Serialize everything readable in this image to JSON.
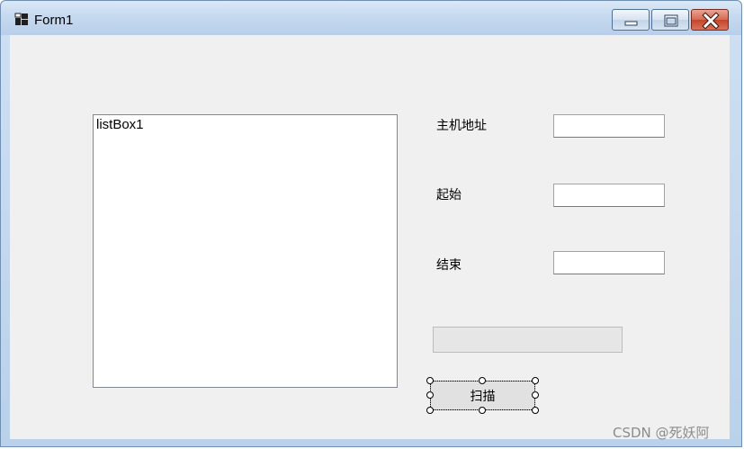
{
  "window": {
    "title": "Form1"
  },
  "listbox": {
    "items": [
      "listBox1"
    ]
  },
  "form": {
    "host_label": "主机地址",
    "host_value": "",
    "start_label": "起始",
    "start_value": "",
    "end_label": "结束",
    "end_value": "",
    "progress": 0,
    "scan_label": "扫描"
  },
  "watermark": "CSDN @死妖阿"
}
